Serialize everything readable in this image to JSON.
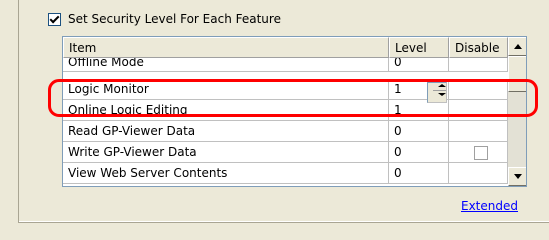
{
  "checkbox": {
    "label": "Set Security Level For Each Feature",
    "checked": true
  },
  "table": {
    "headers": {
      "item": "Item",
      "level": "Level",
      "disable": "Disable"
    },
    "rows": [
      {
        "item": "Offline Mode",
        "level": "0"
      },
      {
        "item": "Logic Monitor",
        "level": "1"
      },
      {
        "item": "Online Logic Editing",
        "level": "1"
      },
      {
        "item": "Read GP-Viewer Data",
        "level": "0"
      },
      {
        "item": "Write GP-Viewer Data",
        "level": "0"
      },
      {
        "item": "View Web Server Contents",
        "level": "0"
      }
    ]
  },
  "link": {
    "label": "Extended"
  },
  "colors": {
    "highlight": "#ff0000",
    "link": "#0000ff"
  }
}
